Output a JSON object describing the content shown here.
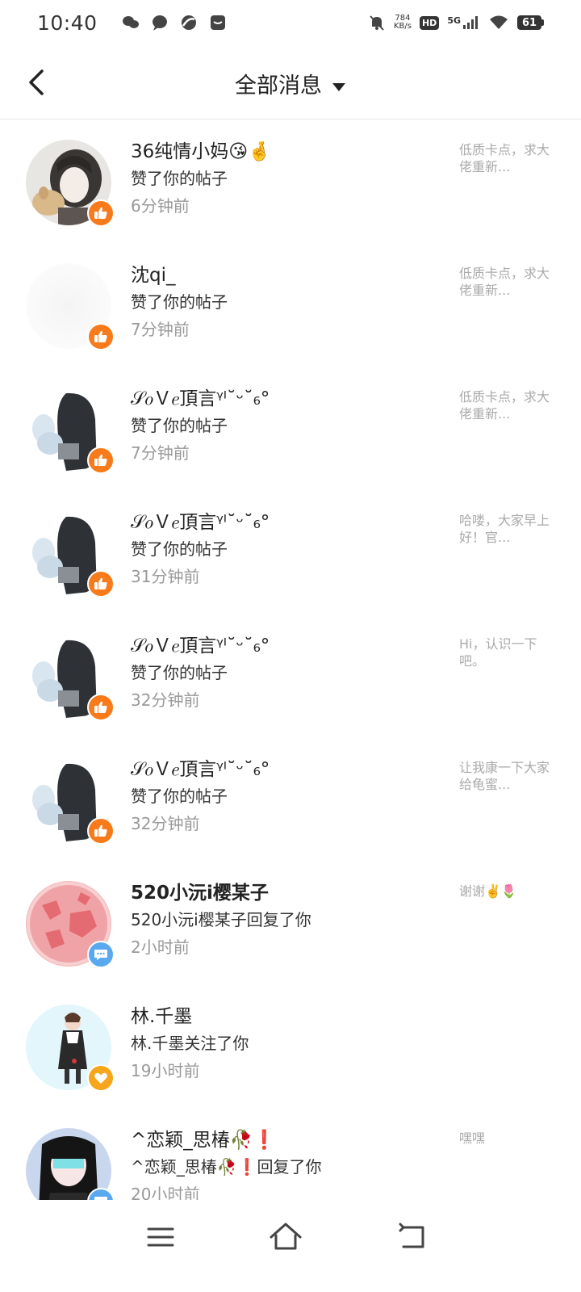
{
  "status_bar": {
    "time": "10:40",
    "net_speed_value": "784",
    "net_speed_unit": "KB/s",
    "hd": "HD",
    "network": "5G",
    "battery": "61"
  },
  "header": {
    "title": "全部消息"
  },
  "colors": {
    "like_badge": "#f77b1b",
    "comment_badge": "#5aa9f0",
    "follow_badge": "#f7a51b"
  },
  "messages": [
    {
      "name": "36纯情小妈😘🤞",
      "action": "赞了你的帖子",
      "time": "6分钟前",
      "preview": "低质卡点，求大佬重新...",
      "badge": "like-icon"
    },
    {
      "name": "沈qi_",
      "action": "赞了你的帖子",
      "time": "7分钟前",
      "preview": "低质卡点，求大佬重新...",
      "badge": "like-icon"
    },
    {
      "name": "𝒮𝑜Ｖ𝑒頂言ᵞᴵ˘ᵕ˘₆°",
      "action": "赞了你的帖子",
      "time": "7分钟前",
      "preview": "低质卡点，求大佬重新...",
      "badge": "like-icon"
    },
    {
      "name": "𝒮𝑜Ｖ𝑒頂言ᵞᴵ˘ᵕ˘₆°",
      "action": "赞了你的帖子",
      "time": "31分钟前",
      "preview": "哈喽，大家早上好！官...",
      "badge": "like-icon"
    },
    {
      "name": "𝒮𝑜Ｖ𝑒頂言ᵞᴵ˘ᵕ˘₆°",
      "action": "赞了你的帖子",
      "time": "32分钟前",
      "preview": "Hi，认识一下吧。",
      "badge": "like-icon"
    },
    {
      "name": "𝒮𝑜Ｖ𝑒頂言ᵞᴵ˘ᵕ˘₆°",
      "action": "赞了你的帖子",
      "time": "32分钟前",
      "preview": "让我康一下大家给龟蜜...",
      "badge": "like-icon"
    },
    {
      "name": "520小沅i樱某子",
      "action": "520小沅i樱某子回复了你",
      "time": "2小时前",
      "preview": "谢谢✌️🌷",
      "badge": "comment-icon"
    },
    {
      "name": "林.千墨",
      "action": "林.千墨关注了你",
      "time": "19小时前",
      "preview": "",
      "badge": "heart-icon"
    },
    {
      "name": "^恋颖_思椿🥀❗",
      "action": "^恋颖_思椿🥀❗回复了你",
      "time": "20小时前",
      "preview": "嘿嘿",
      "badge": "comment-icon"
    }
  ]
}
